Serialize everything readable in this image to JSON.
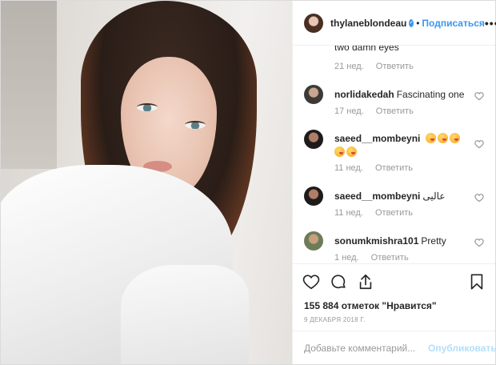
{
  "header": {
    "username": "thylaneblondeau",
    "follow_label": "Подписаться",
    "separator": "•",
    "more_label": "•••"
  },
  "comments": [
    {
      "username": "",
      "text": "two damn eyes",
      "age": "21 нед.",
      "reply_label": "Ответить"
    },
    {
      "username": "norlidakedah",
      "text": "Fascinating one",
      "age": "17 нед.",
      "reply_label": "Ответить"
    },
    {
      "username": "saeed__mombeyni",
      "text": "",
      "emoji_count": 5,
      "age": "11 нед.",
      "reply_label": "Ответить"
    },
    {
      "username": "saeed__mombeyni",
      "text": "عالیی",
      "age": "11 нед.",
      "reply_label": "Ответить"
    },
    {
      "username": "sonumkmishra101",
      "text": "Pretty",
      "age": "1 нед.",
      "reply_label": "Ответить"
    }
  ],
  "likes": "155 884 отметок \"Нравится\"",
  "date": "9 ДЕКАБРЯ 2018 Г.",
  "add_comment": {
    "placeholder": "Добавьте комментарий...",
    "publish_label": "Опубликовать"
  },
  "icons": {
    "like": "heart-icon",
    "comment": "comment-icon",
    "share": "share-icon",
    "save": "bookmark-icon",
    "verified": "verified-badge-icon",
    "comment_like": "heart-outline-icon"
  },
  "colors": {
    "accent": "#3897f0",
    "publish_disabled": "#b2dffc",
    "meta_text": "#999999"
  }
}
